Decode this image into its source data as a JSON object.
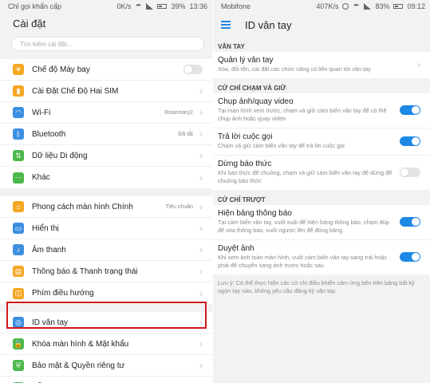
{
  "left": {
    "status": {
      "carrier": "Chỉ gọi khẩn cấp",
      "speed": "0K/s",
      "battery": "39%",
      "time": "13:36"
    },
    "title": "Cài đặt",
    "search_placeholder": "Tìm kiếm cài đặt...",
    "groups": [
      {
        "items": [
          {
            "label": "Chế độ Máy bay",
            "icon": "airplane-icon",
            "color": "#f5a623",
            "glyph": "✈",
            "type": "toggle",
            "on": false
          },
          {
            "label": "Cài Đặt Chế Độ Hai SIM",
            "icon": "sim-icon",
            "color": "#f5a623",
            "glyph": "▮",
            "type": "chev"
          },
          {
            "label": "Wi-Fi",
            "icon": "wifi-icon",
            "color": "#3d8fe0",
            "glyph": "◠",
            "type": "chev",
            "value": "Rosemary2"
          },
          {
            "label": "Bluetooth",
            "icon": "bluetooth-icon",
            "color": "#3d8fe0",
            "glyph": "ᛒ",
            "type": "chev",
            "value": "Đã tắt"
          },
          {
            "label": "Dữ liệu Di động",
            "icon": "mobile-data-icon",
            "color": "#4cb84c",
            "glyph": "⇅",
            "type": "chev"
          },
          {
            "label": "Khác",
            "icon": "more-icon",
            "color": "#4cb84c",
            "glyph": "⋯",
            "type": "chev"
          }
        ]
      },
      {
        "items": [
          {
            "label": "Phong cách màn hình Chính",
            "icon": "home-style-icon",
            "color": "#f5a623",
            "glyph": "⌂",
            "type": "chev",
            "value": "Tiêu chuẩn"
          },
          {
            "label": "Hiển thị",
            "icon": "display-icon",
            "color": "#3d8fe0",
            "glyph": "▭",
            "type": "chev"
          },
          {
            "label": "Âm thanh",
            "icon": "sound-icon",
            "color": "#3d8fe0",
            "glyph": "♪",
            "type": "chev"
          },
          {
            "label": "Thông báo & Thanh trạng thái",
            "icon": "notification-icon",
            "color": "#f5a623",
            "glyph": "▤",
            "type": "chev"
          },
          {
            "label": "Phím điều hướng",
            "icon": "nav-keys-icon",
            "color": "#f5a623",
            "glyph": "◫",
            "type": "chev"
          }
        ]
      },
      {
        "items": [
          {
            "label": "ID vân tay",
            "icon": "fingerprint-icon",
            "color": "#3d8fe0",
            "glyph": "◎",
            "type": "chev"
          },
          {
            "label": "Khóa màn hình & Mật khẩu",
            "icon": "lock-icon",
            "color": "#4cb84c",
            "glyph": "🔒",
            "type": "chev"
          },
          {
            "label": "Bảo mật & Quyền riêng tư",
            "icon": "shield-icon",
            "color": "#4cb84c",
            "glyph": "⛨",
            "type": "chev"
          },
          {
            "label": "Hỗ trợ thông minh",
            "icon": "assist-icon",
            "color": "#4cb84c",
            "glyph": "✋",
            "type": "chev"
          }
        ]
      }
    ]
  },
  "right": {
    "status": {
      "carrier": "Mobifone",
      "speed": "407K/s",
      "battery": "83%",
      "time": "09:12"
    },
    "title": "ID vân tay",
    "sections": [
      {
        "header": "VÂN TAY",
        "items": [
          {
            "title": "Quản lý vân tay",
            "sub": "Xóa, đổi tên, cài đặt các chức năng có liên quan tới vân tay",
            "control": "chev"
          }
        ]
      },
      {
        "header": "CỬ CHỈ CHẠM VÀ GIỮ",
        "items": [
          {
            "title": "Chụp ảnh/quay video",
            "sub": "Tại màn hình xem trước, chạm và giữ cảm biến vân tay để có thể chụp ảnh hoặc quay video",
            "control": "on"
          },
          {
            "title": "Trả lời cuộc gọi",
            "sub": "Chạm và giữ cảm biến vân tay để trả lời cuộc gọi",
            "control": "on"
          },
          {
            "title": "Dừng báo thức",
            "sub": "Khi báo thức để chuông, chạm và giữ cảm biến vân tay để dừng để chuông báo thức",
            "control": "off"
          }
        ]
      },
      {
        "header": "CỬ CHỈ TRƯỢT",
        "items": [
          {
            "title": "Hiện bảng thông báo",
            "sub": "Tại cảm biến vân tay, vuốt xuôi để hiện bảng thông báo, chạm đúp để xóa thông báo, vuốt ngược lên để đóng bảng",
            "control": "on"
          },
          {
            "title": "Duyệt ảnh",
            "sub": "Khi xem ảnh toàn màn hình, vuốt cảm biến vân tay sang trái hoặc phải để chuyển sang ảnh trước hoặc sau",
            "control": "on"
          }
        ]
      }
    ],
    "note": "Lưu ý: Có thể thực hiện các cử chỉ điều khiển cảm ứng bên trên bảng bất kỳ ngón tay nào, không yêu cầu đăng ký vân tay."
  }
}
